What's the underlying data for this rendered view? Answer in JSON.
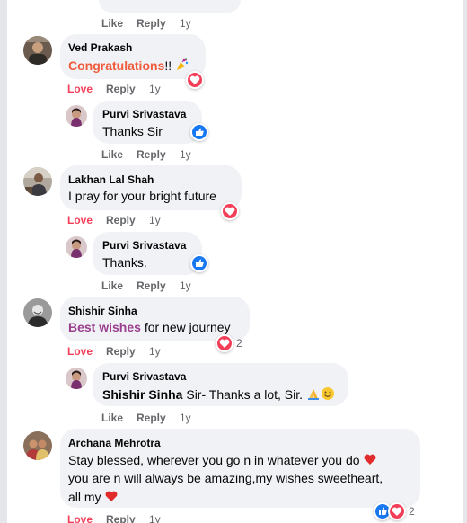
{
  "colors": {
    "love": "#f33e58",
    "like": "#1877f2",
    "mention_orange": "#f05b3c",
    "mention_purple": "#9b3f8e"
  },
  "top_actions": {
    "like": "Like",
    "reply": "Reply",
    "time": "1y"
  },
  "comments": [
    {
      "author": "Ved Prakash",
      "highlight": "Congratulations",
      "text": "!!",
      "emoji": "party-popper-icon",
      "reaction": "love",
      "actions": {
        "love": "Love",
        "reply": "Reply",
        "time": "1y"
      },
      "reply": {
        "author": "Purvi Srivastava",
        "text": "Thanks Sir",
        "reaction": "like",
        "actions": {
          "like": "Like",
          "reply": "Reply",
          "time": "1y"
        }
      }
    },
    {
      "author": "Lakhan Lal Shah",
      "text": "I pray for your bright future",
      "reaction": "love",
      "actions": {
        "love": "Love",
        "reply": "Reply",
        "time": "1y"
      },
      "reply": {
        "author": "Purvi Srivastava",
        "text": "Thanks.",
        "reaction": "like",
        "actions": {
          "like": "Like",
          "reply": "Reply",
          "time": "1y"
        }
      }
    },
    {
      "author": "Shishir Sinha",
      "highlight": "Best wishes",
      "text": " for new journey",
      "reaction": "love",
      "reaction_count": "2",
      "actions": {
        "love": "Love",
        "reply": "Reply",
        "time": "1y"
      },
      "reply": {
        "author": "Purvi Srivastava",
        "mention": "Shishir Sinha",
        "text": " Sir- Thanks a lot, Sir.",
        "emojis": [
          "folded-hands-icon",
          "smiling-face-icon"
        ],
        "actions": {
          "like": "Like",
          "reply": "Reply",
          "time": "1y"
        }
      }
    },
    {
      "author": "Archana Mehrotra",
      "lines": [
        "Stay blessed, wherever you go n in whatever you do",
        "you are n will always be amazing,my wishes sweetheart,",
        "all my"
      ],
      "reactions": [
        "like",
        "love"
      ],
      "reaction_count": "2",
      "actions": {
        "love": "Love",
        "reply": "Reply",
        "time": "1y"
      }
    }
  ]
}
